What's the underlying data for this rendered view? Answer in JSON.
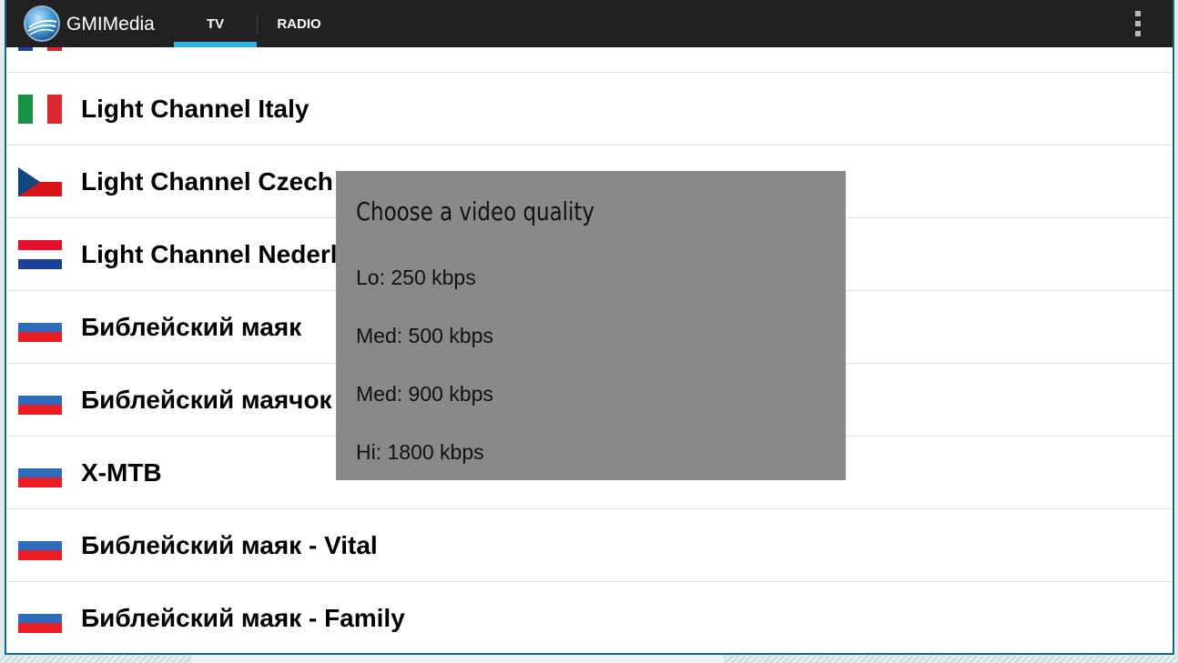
{
  "app": {
    "title": "GMIMedia",
    "logo_icon": "globe-logo-icon"
  },
  "tabs": [
    {
      "label": "TV",
      "selected": true
    },
    {
      "label": "RADIO",
      "selected": false
    }
  ],
  "colors": {
    "actionbar": "#212121",
    "tab_indicator": "#33b5e5",
    "dialog_bg": "#898989"
  },
  "channels": [
    {
      "label": "",
      "flag": "fr"
    },
    {
      "label": "Light Channel Italy",
      "flag": "it"
    },
    {
      "label": "Light Channel Czech R",
      "flag": "cz"
    },
    {
      "label": "Light Channel Nederland",
      "flag": "nl"
    },
    {
      "label": "Библейский маяк",
      "flag": "ru"
    },
    {
      "label": "Библейский маячок",
      "flag": "ru"
    },
    {
      "label": "X-MTB",
      "flag": "ru"
    },
    {
      "label": "Библейский маяк - Vital",
      "flag": "ru"
    },
    {
      "label": "Библейский маяк - Family",
      "flag": "ru"
    }
  ],
  "dialog": {
    "title": "Choose a video quality",
    "options": [
      "Lo: 250 kbps",
      "Med: 500 kbps",
      "Med: 900 kbps",
      "Hi: 1800 kbps"
    ]
  }
}
